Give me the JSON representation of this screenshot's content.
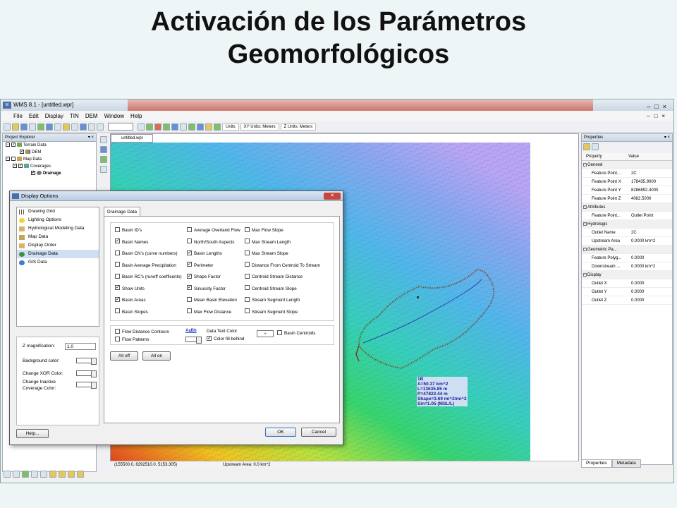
{
  "slide": {
    "title_line1": "Activación de los Parámetros",
    "title_line2": "Geomorfológicos"
  },
  "window": {
    "title": "WMS 8.1 - [untitled.wpr]",
    "menu": [
      "File",
      "Edit",
      "Display",
      "TIN",
      "DEM",
      "Window",
      "Help"
    ],
    "toolbar": {
      "units_label": "Units",
      "xy_units": "XY Units: Meters",
      "z_units": "Z Units: Meters"
    }
  },
  "explorer": {
    "header": "Project Explorer",
    "items": [
      {
        "label": "Terrain Data",
        "level": 0,
        "checked": true,
        "expanded": true
      },
      {
        "label": "DEM",
        "level": 1,
        "checked": true
      },
      {
        "label": "Map Data",
        "level": 0,
        "checked": false,
        "expanded": true
      },
      {
        "label": "Coverages",
        "level": 1,
        "checked": true,
        "expanded": true
      },
      {
        "label": "Drainage",
        "level": 2,
        "checked": true
      }
    ]
  },
  "map": {
    "tab_label": "untitled.wpr",
    "annotation": [
      "1B",
      "A=50.37 km^2",
      "L=13635.85 m",
      "P=47822.44 m",
      "Shape=3.60 mi^2/mi^2",
      "Sin=1.05 (MSL/L)"
    ],
    "coord_readout": "(155500.0, 8292510.0, 5153.305)",
    "status_text": "Upstream Area: 0.0 km^2"
  },
  "properties": {
    "header": "Properties",
    "col_property": "Property",
    "col_value": "Value",
    "sections": [
      {
        "name": "General",
        "rows": [
          {
            "k": "Feature Point...",
            "v": "2C"
          },
          {
            "k": "Feature Point X",
            "v": "178435.9000"
          },
          {
            "k": "Feature Point Y",
            "v": "8286892.4000"
          },
          {
            "k": "Feature Point Z",
            "v": "4082.5000"
          }
        ]
      },
      {
        "name": "Attributes",
        "rows": [
          {
            "k": "Feature Point...",
            "v": "Outlet Point"
          }
        ]
      },
      {
        "name": "Hydrologic",
        "rows": [
          {
            "k": "Outlet Name",
            "v": "2C"
          },
          {
            "k": "Upstream Area",
            "v": "0.0000 km^2"
          }
        ]
      },
      {
        "name": "Geometric Pa...",
        "rows": [
          {
            "k": "Feature Polyg...",
            "v": "0.0000"
          },
          {
            "k": "Downstream ...",
            "v": "0.0000 km^2"
          }
        ]
      },
      {
        "name": "Display",
        "rows": [
          {
            "k": "Outlet X",
            "v": "0.0000"
          },
          {
            "k": "Outlet Y",
            "v": "0.0000"
          },
          {
            "k": "Outlet Z",
            "v": "0.0000"
          }
        ]
      }
    ],
    "tabs": [
      "Properties",
      "Metadata"
    ]
  },
  "dialog": {
    "title": "Display Options",
    "list": [
      "Drawing Grid",
      "Lighting Options",
      "Hydrological Modeling Data",
      "Map Data",
      "Display Order",
      "Drainage Data",
      "GIS Data"
    ],
    "selected_index": 5,
    "z_mag_label": "Z magnification:",
    "z_mag_value": "1.0",
    "bg_color_label": "Background color:",
    "xor_label": "Change XOR Color:",
    "inactive_label_1": "Change Inactive",
    "inactive_label_2": "Coverage Color:",
    "tab": "Drainage Data",
    "checkboxes": [
      {
        "label": "Basin ID's",
        "checked": false
      },
      {
        "label": "Basin Names",
        "checked": true
      },
      {
        "label": "Basin CN's (curve numbers)",
        "checked": false
      },
      {
        "label": "Basin Average Precipitation",
        "checked": false
      },
      {
        "label": "Basin RC's (runoff coefficents)",
        "checked": false
      },
      {
        "label": "Show Units",
        "checked": true
      },
      {
        "label": "Basin Areas",
        "checked": true
      },
      {
        "label": "Basin Slopes",
        "checked": false
      },
      {
        "label": "Average Overland Flow",
        "checked": false
      },
      {
        "label": "North/South Aspects",
        "checked": false
      },
      {
        "label": "Basin Lengths",
        "checked": true
      },
      {
        "label": "Perimeter",
        "checked": true
      },
      {
        "label": "Shape Factor",
        "checked": true
      },
      {
        "label": "Sinuosity Factor",
        "checked": true
      },
      {
        "label": "Mean Basin Elevation",
        "checked": false
      },
      {
        "label": "Max Flow Distance",
        "checked": false
      },
      {
        "label": "Max Flow Slope",
        "checked": false
      },
      {
        "label": "Max Stream Length",
        "checked": false
      },
      {
        "label": "Max Stream Slope",
        "checked": false
      },
      {
        "label": "Distance From Centroid To Stream",
        "checked": false
      },
      {
        "label": "Centroid Stream Distance",
        "checked": false
      },
      {
        "label": "Centroid Stream Slope",
        "checked": false
      },
      {
        "label": "Stream Segment Length",
        "checked": false
      },
      {
        "label": "Stream Segment Slope",
        "checked": false
      }
    ],
    "flow_contours": "Flow Distance Contours",
    "flow_patterns": "Flow Patterns",
    "aabb": "AaBb",
    "data_text_color": "Data Text Color",
    "color_fill": "Color fill behind",
    "color_fill_checked": true,
    "basin_centroids": "Basin Centroids",
    "all_off": "All off",
    "all_on": "All on",
    "help": "Help...",
    "ok": "OK",
    "cancel": "Cancel"
  },
  "colors": {
    "basin_outline": "#7a3a1a",
    "annotation_text": "#1a1a9a",
    "dialog_close": "#c9463d"
  }
}
